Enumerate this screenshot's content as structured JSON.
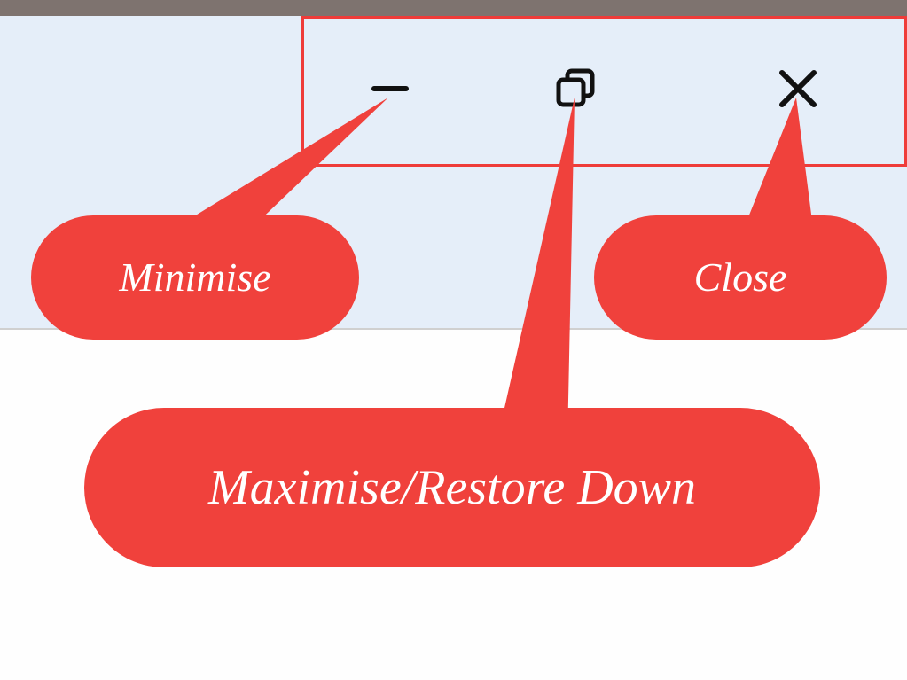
{
  "colors": {
    "highlight": "#ef3c3a",
    "callout_bg": "#f0413c",
    "callout_text": "#ffffff",
    "titlebar_bg": "#e5eef9",
    "top_strip": "#7e736f"
  },
  "window_controls": {
    "minimise": {
      "icon": "minimise-icon"
    },
    "maximise_restore": {
      "icon": "restore-icon"
    },
    "close": {
      "icon": "close-icon"
    }
  },
  "callouts": {
    "minimise": "Minimise",
    "maximise_restore": "Maximise/Restore Down",
    "close": "Close"
  }
}
